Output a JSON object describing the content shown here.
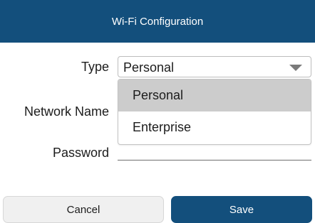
{
  "header": {
    "title": "Wi-Fi Configuration"
  },
  "form": {
    "type_label": "Type",
    "network_name_label": "Network Name",
    "password_label": "Password",
    "type_value": "Personal",
    "type_options": [
      "Personal",
      "Enterprise"
    ],
    "network_name_value": "",
    "password_value": ""
  },
  "buttons": {
    "cancel_label": "Cancel",
    "save_label": "Save"
  },
  "icons": {
    "dropdown": "chevron-down-icon"
  },
  "colors": {
    "header_bg": "#134f7c",
    "save_bg": "#134f7c",
    "selected_option_bg": "#cccccc"
  }
}
